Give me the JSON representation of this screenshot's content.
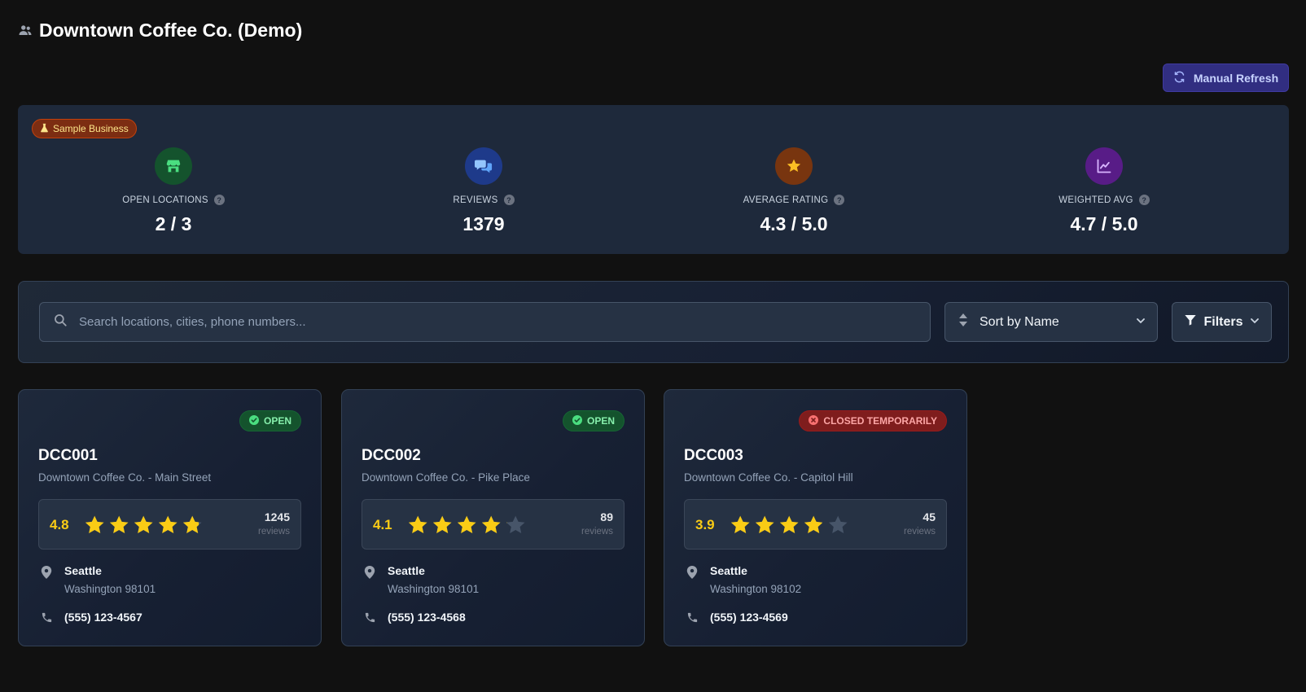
{
  "header": {
    "title": "Downtown Coffee Co. (Demo)",
    "icon": "users-icon"
  },
  "toolbar": {
    "refresh_label": "Manual Refresh"
  },
  "stats": {
    "badge": "Sample Business",
    "items": [
      {
        "label": "OPEN LOCATIONS",
        "value": "2 / 3",
        "icon": "store-icon",
        "color": "#14532d"
      },
      {
        "label": "REVIEWS",
        "value": "1379",
        "icon": "chat-bubbles-icon",
        "color": "#1e3a8a"
      },
      {
        "label": "AVERAGE RATING",
        "value": "4.3 / 5.0",
        "icon": "star-icon",
        "color": "#78350f"
      },
      {
        "label": "WEIGHTED AVG",
        "value": "4.7 / 5.0",
        "icon": "chart-line-icon",
        "color": "#581c87"
      }
    ]
  },
  "filters": {
    "search_placeholder": "Search locations, cities, phone numbers...",
    "sort_label": "Sort by Name",
    "filters_label": "Filters"
  },
  "locations": [
    {
      "status": "OPEN",
      "status_type": "open",
      "code": "DCC001",
      "name": "Downtown Coffee Co. - Main Street",
      "rating": 4.8,
      "rating_text": "4.8",
      "reviews": "1245",
      "reviews_label": "reviews",
      "city": "Seattle",
      "state": "Washington 98101",
      "phone": "(555) 123-4567"
    },
    {
      "status": "OPEN",
      "status_type": "open",
      "code": "DCC002",
      "name": "Downtown Coffee Co. - Pike Place",
      "rating": 4.1,
      "rating_text": "4.1",
      "reviews": "89",
      "reviews_label": "reviews",
      "city": "Seattle",
      "state": "Washington 98101",
      "phone": "(555) 123-4568"
    },
    {
      "status": "CLOSED TEMPORARILY",
      "status_type": "closed",
      "code": "DCC003",
      "name": "Downtown Coffee Co. - Capitol Hill",
      "rating": 3.9,
      "rating_text": "3.9",
      "reviews": "45",
      "reviews_label": "reviews",
      "city": "Seattle",
      "state": "Washington 98102",
      "phone": "(555) 123-4569"
    }
  ],
  "colors": {
    "accent": "#312e81",
    "star": "#facc15",
    "star_empty": "#475569",
    "open": "#86efac",
    "closed": "#fca5a5"
  }
}
